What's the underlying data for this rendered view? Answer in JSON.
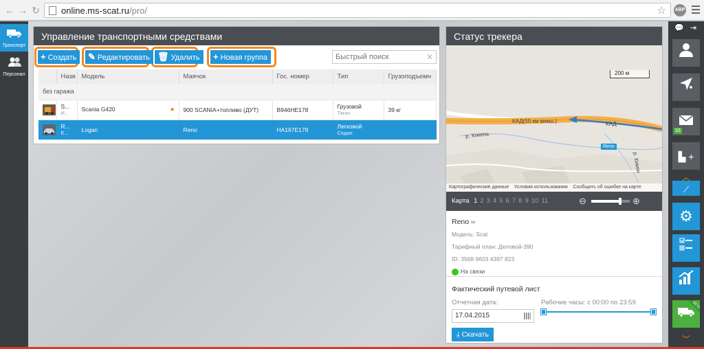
{
  "browser": {
    "url_host": "online.ms-scat.ru",
    "url_path": "/pro/",
    "adblock_label": "ABP"
  },
  "left_sidebar": {
    "items": [
      {
        "label": "Транспорт",
        "icon": "truck-icon"
      },
      {
        "label": "Персонал",
        "icon": "people-icon"
      }
    ]
  },
  "vehicle_panel": {
    "title": "Управление транспортными средствами",
    "toolbar": {
      "create": "Создать",
      "edit": "Редактировать",
      "delete": "Удалить",
      "new_group": "Новая группа"
    },
    "search_placeholder": "Быстрый поиск",
    "columns": [
      "Назв",
      "Модель",
      "Маячок",
      "Гос. номер",
      "Тип",
      "Грузоподъемн"
    ],
    "group_label": "без гаража",
    "rows": [
      {
        "name_line1": "S...",
        "name_line2": "И...",
        "model": "Scania G420",
        "beacon": "900 SCANIA+топливо (ДУТ)",
        "plate": "B946HE178",
        "type": "Грузовой",
        "subtype": "Тягач",
        "capacity": "39 кг"
      },
      {
        "name_line1": "R...",
        "name_line2": "Е...",
        "model": "Logan",
        "beacon": "Reno",
        "plate": "HA167E178",
        "type": "Легковой",
        "subtype": "Седан",
        "capacity": ""
      }
    ]
  },
  "tracker_panel": {
    "title": "Статус трекера",
    "map": {
      "scale": "200 м",
      "road_label": "КАД(55 км внеш.)",
      "road_label_right": "КАД",
      "river_label": "р. Кикень",
      "river_label2": "р. Кикен",
      "badge": "Reno",
      "credits": [
        "Картографические данные",
        "Условия использования",
        "Сообщить об ошибке на карте"
      ]
    },
    "map_pages_label": "Карта",
    "map_pages": [
      "1",
      "2",
      "3",
      "4",
      "5",
      "6",
      "7",
      "8",
      "9",
      "10",
      "11"
    ],
    "zoom_level": 0.75,
    "vehicle": {
      "name": "Reno",
      "model": "Модель: Scat",
      "tariff": "Тарифный план: Деловой-390",
      "id": "ID: 3568 9603 4397 823",
      "status": "На связи"
    },
    "waybill": {
      "title": "Фактический путевой лист",
      "date_label": "Отчетная дата:",
      "date_value": "17.04.2015",
      "hours_label": "Рабочие часы: с 00:00 по 23:59",
      "download": "Скачать"
    }
  },
  "right_sidebar": {
    "messages_count": "33",
    "beta_label": "BETA"
  },
  "colors": {
    "accent": "#2396d8",
    "highlight": "#f08a1e",
    "dark": "#4a4d52",
    "online": "#41c21d"
  }
}
